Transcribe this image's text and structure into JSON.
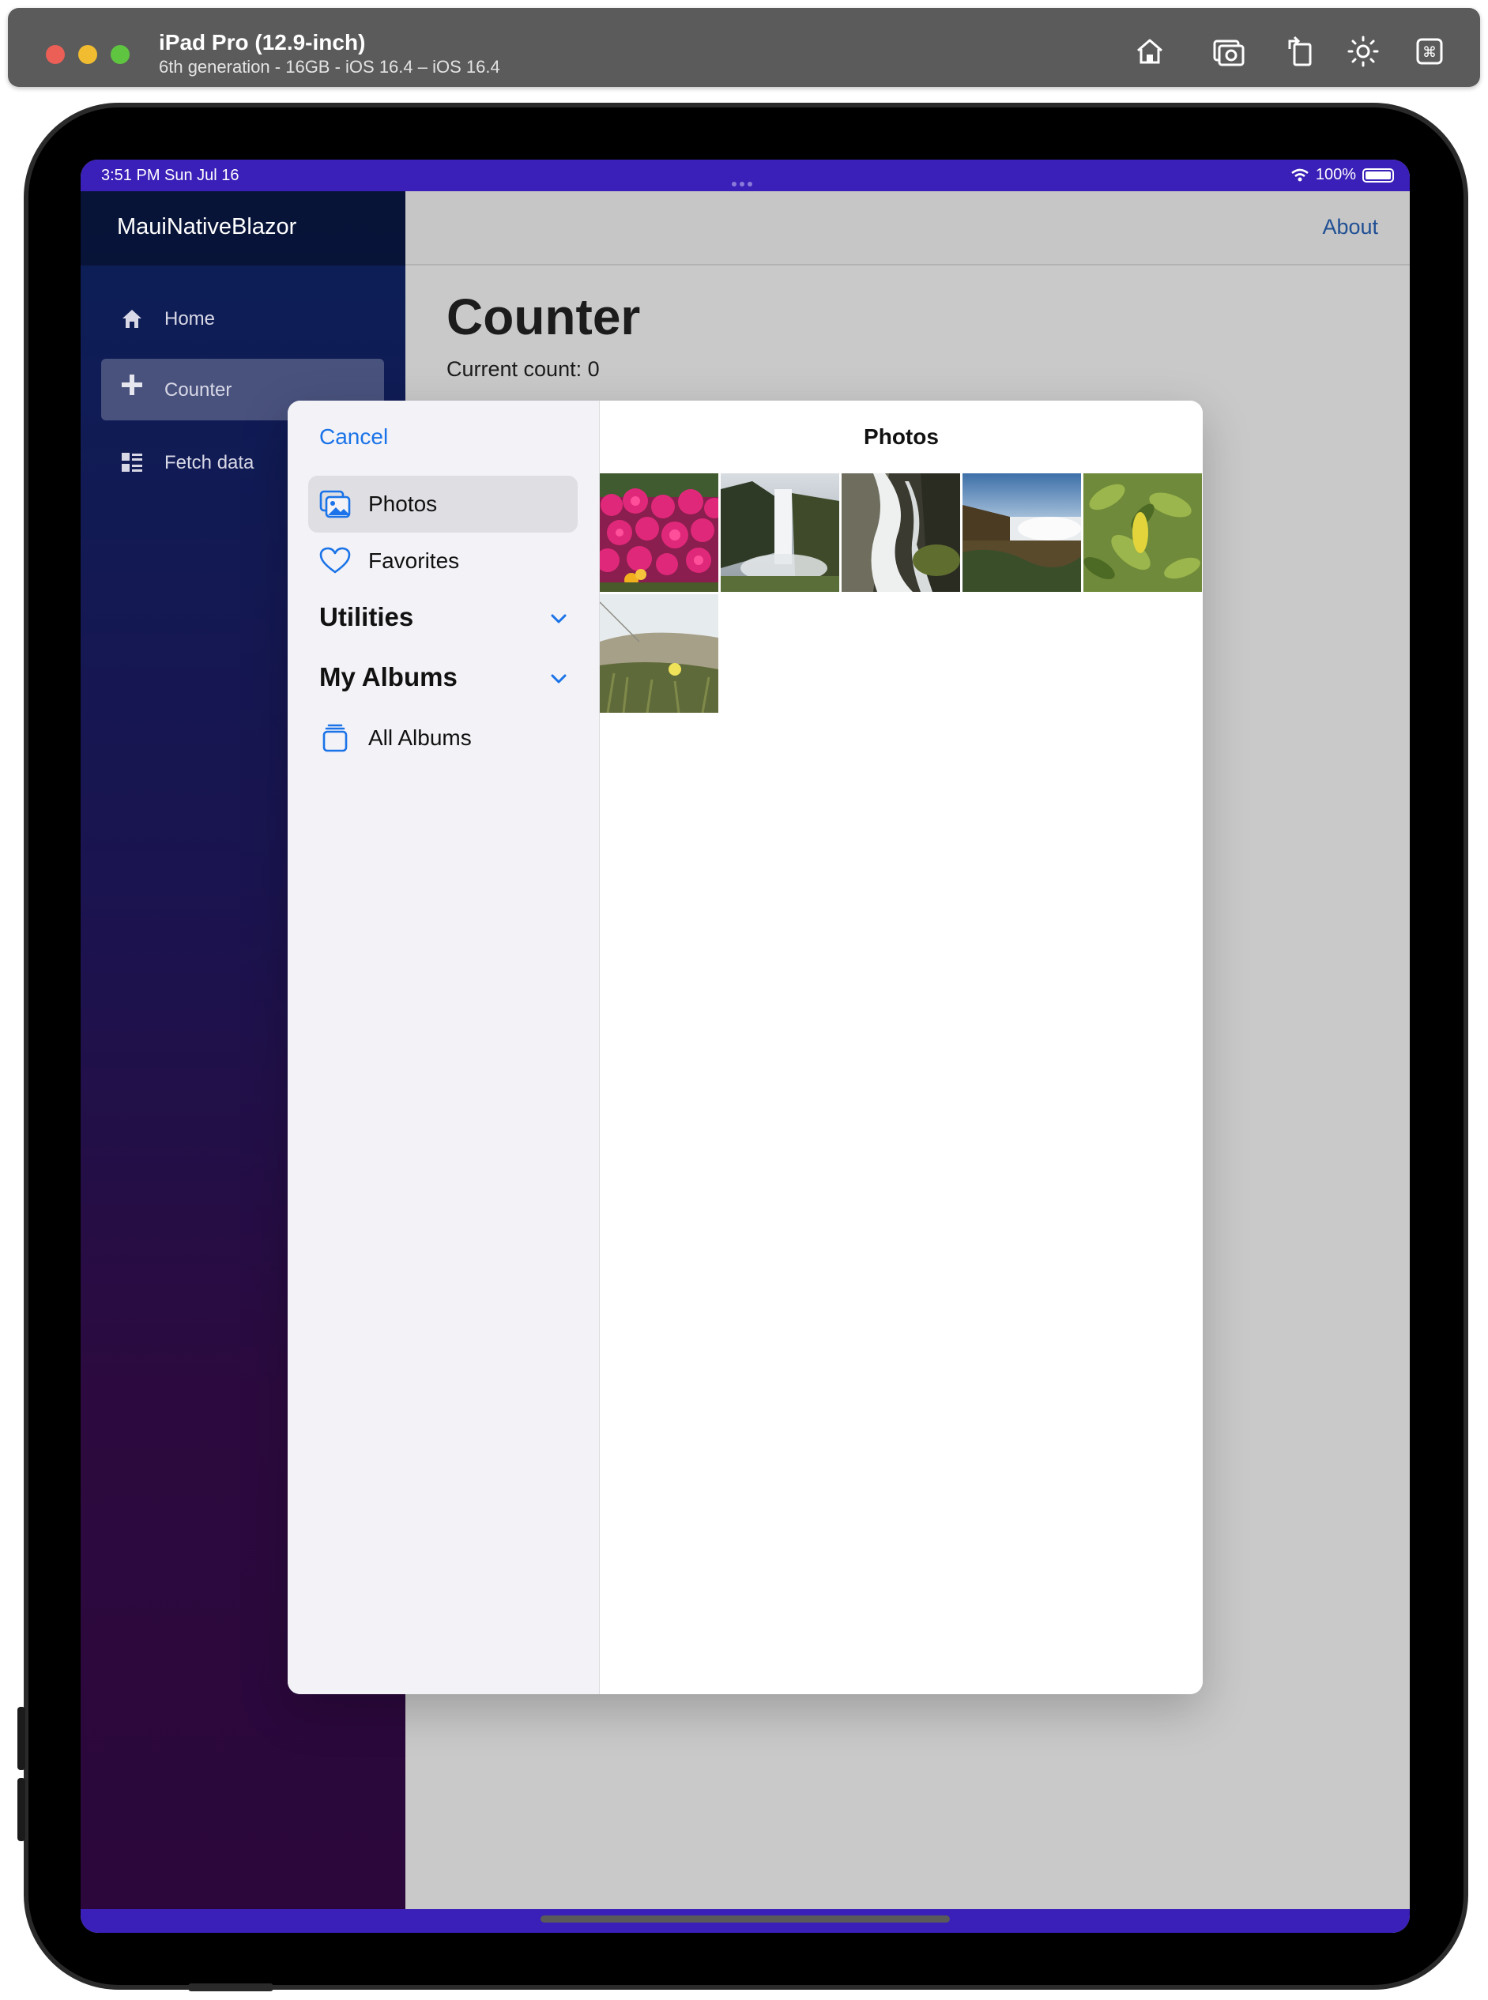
{
  "simulator": {
    "title": "iPad Pro (12.9-inch)",
    "subtitle": "6th generation - 16GB - iOS 16.4 – iOS 16.4",
    "toolbar": [
      "home-icon",
      "screenshot-icon",
      "rotate-icon",
      "brightness-icon",
      "command-icon"
    ]
  },
  "status_bar": {
    "time": "3:51 PM   Sun Jul 16",
    "battery": "100%"
  },
  "app": {
    "brand": "MauiNativeBlazor",
    "top_link": "About",
    "nav": [
      {
        "label": "Home",
        "icon": "home-icon",
        "active": false
      },
      {
        "label": "Counter",
        "icon": "plus-icon",
        "active": true
      },
      {
        "label": "Fetch data",
        "icon": "list-icon",
        "active": false
      }
    ],
    "page_title": "Counter",
    "current_count": "Current count: 0"
  },
  "picker": {
    "cancel_label": "Cancel",
    "title": "Photos",
    "library": [
      {
        "label": "Photos",
        "icon": "photos-icon",
        "selected": true
      },
      {
        "label": "Favorites",
        "icon": "heart-icon",
        "selected": false
      }
    ],
    "sections": [
      {
        "label": "Utilities",
        "icon": "chevron-down-icon"
      },
      {
        "label": "My Albums",
        "icon": "chevron-down-icon"
      }
    ],
    "albums": [
      {
        "label": "All Albums",
        "icon": "albums-icon"
      }
    ],
    "photos": [
      "flowers-photo",
      "waterfall-photo",
      "cascade-photo",
      "falls-photo",
      "leaves-photo",
      "dune-photo"
    ]
  },
  "colors": {
    "accent": "#1a73e8",
    "status_bar": "#3a1fb8",
    "link": "#1f4f94"
  }
}
